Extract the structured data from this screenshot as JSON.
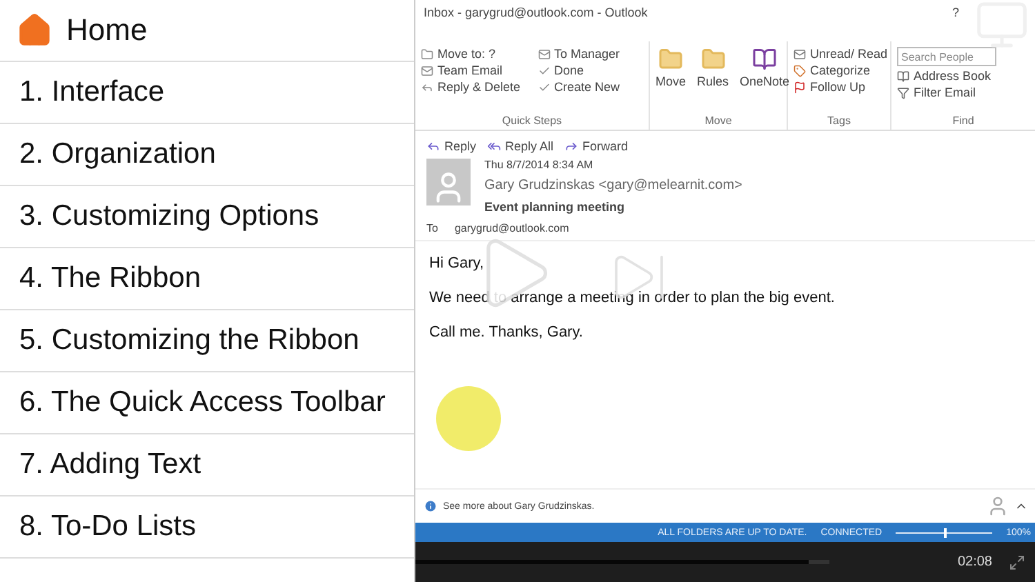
{
  "menu": {
    "home": "Home",
    "items": [
      {
        "label": "1. Interface",
        "selected": false
      },
      {
        "label": "2. Organization",
        "selected": false
      },
      {
        "label": "3. Customizing Options",
        "selected": false
      },
      {
        "label": "4. The Ribbon",
        "selected": false
      },
      {
        "label": "5. Customizing the Ribbon",
        "selected": false
      },
      {
        "label": "6. The Quick Access Toolbar",
        "selected": false
      },
      {
        "label": "7. Adding Text",
        "selected": false
      },
      {
        "label": "8. To-Do Lists",
        "selected": false
      }
    ]
  },
  "video": {
    "window_title": "Inbox - garygrud@outlook.com - Outlook",
    "window_buttons": [
      "?"
    ],
    "quick_steps": {
      "items": [
        "Move to: ?",
        "To Manager",
        "Team Email",
        "Done",
        "Reply & Delete",
        "Create New"
      ],
      "label": "Quick Steps"
    },
    "move": {
      "buttons": [
        "Move",
        "Rules",
        "OneNote"
      ],
      "label": "Move"
    },
    "tags": {
      "items": [
        "Unread/ Read",
        "Categorize",
        "Follow Up"
      ],
      "label": "Tags"
    },
    "find": {
      "search_placeholder": "Search People",
      "items": [
        "Address Book",
        "Filter Email"
      ],
      "label": "Find"
    },
    "actions": [
      "Reply",
      "Reply All",
      "Forward"
    ],
    "message": {
      "date": "Thu 8/7/2014 8:34 AM",
      "from": "Gary Grudzinskas <gary@melearnit.com>",
      "subject": "Event planning meeting",
      "to_label": "To",
      "to": "garygrud@outlook.com",
      "body": [
        "Hi Gary,",
        "We need to arrange a meeting in order to plan the big event.",
        "Call me. Thanks, Gary."
      ]
    },
    "people_info": "See more about Gary Grudzinskas.",
    "status": [
      "ALL FOLDERS ARE UP TO DATE.",
      "CONNECTED"
    ],
    "zoom_label": "100%",
    "zoom": {
      "level": 0.5
    },
    "player": {
      "time": "02:08",
      "progress": {
        "level": 0.95
      }
    }
  }
}
